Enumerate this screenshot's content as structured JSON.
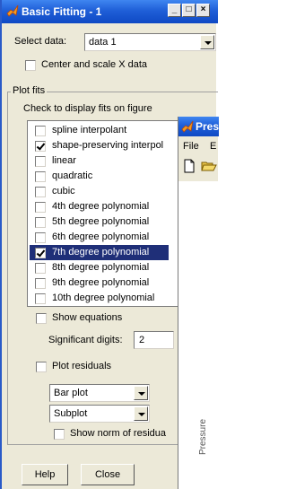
{
  "window": {
    "title": "Basic Fitting - 1",
    "controls": [
      "_",
      "□",
      "×"
    ]
  },
  "select_data": {
    "label": "Select data:",
    "value": "data 1"
  },
  "center_scale": {
    "label": "Center and scale X data",
    "checked": false
  },
  "plot_fits": {
    "group_label": "Plot fits",
    "hint": "Check to display fits on figure",
    "items": [
      {
        "label": "spline interpolant",
        "checked": false,
        "selected": false
      },
      {
        "label": "shape-preserving interpol",
        "checked": true,
        "selected": false
      },
      {
        "label": "linear",
        "checked": false,
        "selected": false
      },
      {
        "label": "quadratic",
        "checked": false,
        "selected": false
      },
      {
        "label": "cubic",
        "checked": false,
        "selected": false
      },
      {
        "label": "4th degree polynomial",
        "checked": false,
        "selected": false
      },
      {
        "label": "5th degree polynomial",
        "checked": false,
        "selected": false
      },
      {
        "label": "6th degree polynomial",
        "checked": false,
        "selected": false
      },
      {
        "label": "7th degree polynomial",
        "checked": true,
        "selected": true
      },
      {
        "label": "8th degree polynomial",
        "checked": false,
        "selected": false
      },
      {
        "label": "9th degree polynomial",
        "checked": false,
        "selected": false
      },
      {
        "label": "10th degree polynomial",
        "checked": false,
        "selected": false
      }
    ]
  },
  "show_equations": {
    "label": "Show equations",
    "checked": false
  },
  "sig_digits": {
    "label": "Significant digits:",
    "value": "2"
  },
  "plot_residuals": {
    "label": "Plot residuals",
    "checked": false
  },
  "residual_type": {
    "value": "Bar plot"
  },
  "residual_location": {
    "value": "Subplot"
  },
  "show_norm": {
    "label": "Show norm of residua",
    "checked": false
  },
  "buttons": {
    "help": "Help",
    "close": "Close"
  },
  "background_window": {
    "title": "Pres",
    "menu": [
      "File",
      "E"
    ],
    "axis_text": "Pressure"
  }
}
